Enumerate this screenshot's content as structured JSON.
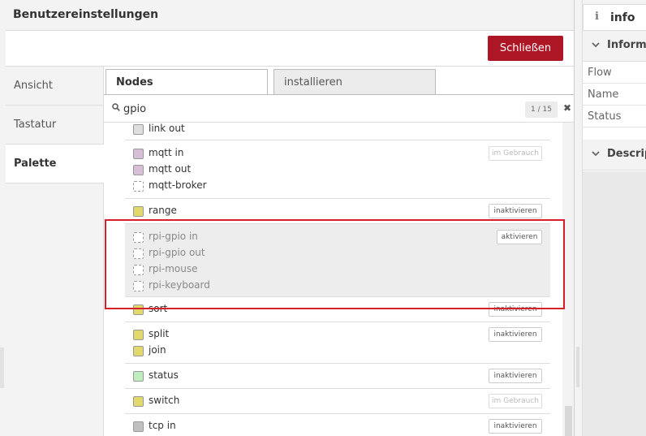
{
  "dialog": {
    "title": "Benutzereinstellungen",
    "close_label": "Schließen"
  },
  "sidebar": {
    "items": [
      {
        "label": "Ansicht",
        "active": false
      },
      {
        "label": "Tastatur",
        "active": false
      },
      {
        "label": "Palette",
        "active": true
      }
    ]
  },
  "tabs": [
    {
      "label": "Nodes",
      "active": true
    },
    {
      "label": "installieren",
      "active": false
    }
  ],
  "search": {
    "value": "gpio",
    "count": "1 / 15"
  },
  "groups": [
    {
      "nodes": [
        {
          "label": "link out",
          "color": "#dddddd"
        }
      ],
      "action": null
    },
    {
      "nodes": [
        {
          "label": "mqtt in",
          "color": "#d8bfd8"
        },
        {
          "label": "mqtt out",
          "color": "#d8bfd8"
        },
        {
          "label": "mqtt-broker",
          "color": null
        }
      ],
      "action": {
        "label": "im Gebrauch",
        "disabled": true
      }
    },
    {
      "nodes": [
        {
          "label": "range",
          "color": "#e2d96e"
        }
      ],
      "action": {
        "label": "inaktivieren",
        "disabled": false
      }
    },
    {
      "nodes": [
        {
          "label": "rpi-gpio in",
          "color": null
        },
        {
          "label": "rpi-gpio out",
          "color": null
        },
        {
          "label": "rpi-mouse",
          "color": null
        },
        {
          "label": "rpi-keyboard",
          "color": null
        }
      ],
      "action": {
        "label": "aktivieren",
        "disabled": false
      },
      "highlight": true
    },
    {
      "nodes": [
        {
          "label": "sort",
          "color": "#e2d96e"
        }
      ],
      "action": {
        "label": "inaktivieren",
        "disabled": false
      }
    },
    {
      "nodes": [
        {
          "label": "split",
          "color": "#e2d96e"
        },
        {
          "label": "join",
          "color": "#e2d96e"
        }
      ],
      "action": {
        "label": "inaktivieren",
        "disabled": false
      }
    },
    {
      "nodes": [
        {
          "label": "status",
          "color": "#c0edc0"
        }
      ],
      "action": {
        "label": "inaktivieren",
        "disabled": false
      }
    },
    {
      "nodes": [
        {
          "label": "switch",
          "color": "#e2d96e"
        }
      ],
      "action": {
        "label": "im Gebrauch",
        "disabled": true
      }
    },
    {
      "nodes": [
        {
          "label": "tcp in",
          "color": "#c0c0c0"
        }
      ],
      "action": {
        "label": "inaktivieren",
        "disabled": false
      }
    }
  ],
  "info_panel": {
    "tab_icon": "i",
    "tab_label": "info",
    "section_label": "Informa",
    "properties": [
      "Flow",
      "Name",
      "Status"
    ],
    "section2_label": "Descrip"
  },
  "colors": {
    "accent": "#ad1625",
    "annotation": "#d8202b"
  }
}
